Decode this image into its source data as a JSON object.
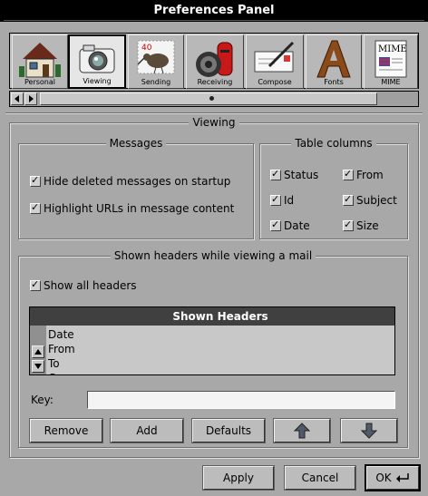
{
  "window": {
    "title": "Preferences Panel"
  },
  "toolbar": {
    "items": [
      {
        "label": "Personal",
        "icon": "house-icon",
        "active": false
      },
      {
        "label": "Viewing",
        "icon": "camera-icon",
        "active": true
      },
      {
        "label": "Sending",
        "icon": "stamp-kiwi-icon",
        "active": false
      },
      {
        "label": "Receiving",
        "icon": "postbox-icon",
        "active": false
      },
      {
        "label": "Compose",
        "icon": "letter-pen-icon",
        "active": false
      },
      {
        "label": "Fonts",
        "icon": "letter-a-icon",
        "active": false
      },
      {
        "label": "MIME",
        "icon": "mime-document-icon",
        "active": false
      }
    ],
    "stamp_text": "40",
    "mime_text": "MIME"
  },
  "section": {
    "title": "Viewing"
  },
  "messages": {
    "title": "Messages",
    "hide_deleted": {
      "label": "Hide deleted messages on startup",
      "checked": true
    },
    "highlight_urls": {
      "label": "Highlight URLs in message content",
      "checked": true
    }
  },
  "table_columns": {
    "title": "Table columns",
    "status": {
      "label": "Status",
      "checked": true
    },
    "from": {
      "label": "From",
      "checked": true
    },
    "id": {
      "label": "Id",
      "checked": true
    },
    "subject": {
      "label": "Subject",
      "checked": true
    },
    "date": {
      "label": "Date",
      "checked": true
    },
    "size": {
      "label": "Size",
      "checked": true
    }
  },
  "headers": {
    "title": "Shown headers while viewing a mail",
    "show_all": {
      "label": "Show all headers",
      "checked": true
    },
    "list_header": "Shown Headers",
    "rows": [
      "Date",
      "From",
      "To",
      "Cc"
    ],
    "key_label": "Key:",
    "key_value": "",
    "remove_label": "Remove",
    "add_label": "Add",
    "defaults_label": "Defaults"
  },
  "footer": {
    "apply_label": "Apply",
    "cancel_label": "Cancel",
    "ok_label": "OK"
  }
}
